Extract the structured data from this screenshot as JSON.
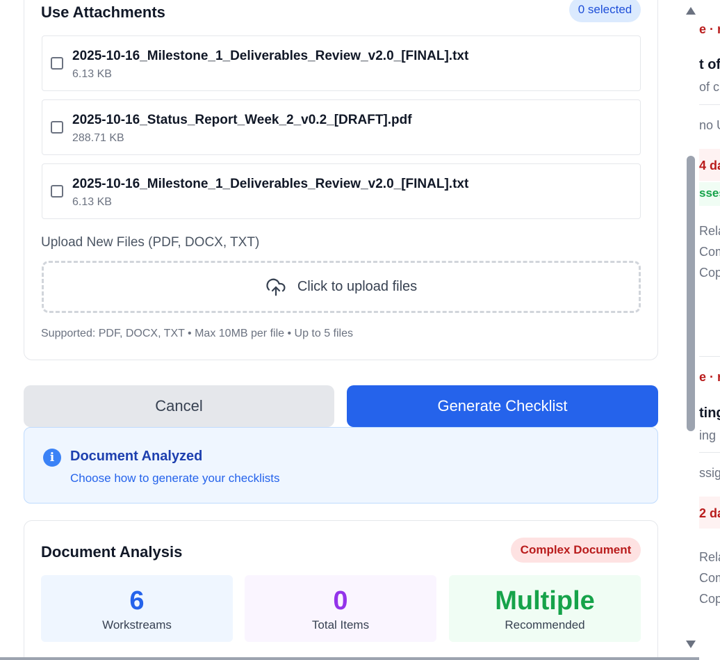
{
  "attachments": {
    "title": "Use Attachments",
    "selected_badge": "0 selected",
    "files": [
      {
        "name": "2025-10-16_Milestone_1_Deliverables_Review_v2.0_[FINAL].txt",
        "size": "6.13 KB",
        "checked": false
      },
      {
        "name": "2025-10-16_Status_Report_Week_2_v0.2_[DRAFT].pdf",
        "size": "288.71 KB",
        "checked": false
      },
      {
        "name": "2025-10-16_Milestone_1_Deliverables_Review_v2.0_[FINAL].txt",
        "size": "6.13 KB",
        "checked": false
      }
    ],
    "upload_label": "Upload New Files (PDF, DOCX, TXT)",
    "upload_prompt": "Click to upload files",
    "upload_icon": "cloud-upload-icon",
    "hint": "Supported: PDF, DOCX, TXT • Max 10MB per file • Up to 5 files"
  },
  "actions": {
    "cancel_label": "Cancel",
    "generate_label": "Generate Checklist"
  },
  "info": {
    "icon": "info-icon",
    "title": "Document Analyzed",
    "subtitle": "Choose how to generate your checklists"
  },
  "analysis": {
    "title": "Document Analysis",
    "badge": "Complex Document",
    "stats": [
      {
        "value": "6",
        "label": "Workstreams",
        "color": "#2563eb",
        "bg": "#eff6ff"
      },
      {
        "value": "0",
        "label": "Total Items",
        "color": "#9333ea",
        "bg": "#faf5ff"
      },
      {
        "value": "Multiple",
        "label": "Recommended",
        "color": "#16a34a",
        "bg": "#f0fdf4"
      }
    ]
  },
  "background": {
    "fragments": [
      "e · r",
      "t of",
      "of c",
      "no U",
      "4 da",
      "sses",
      "Rela",
      "Com",
      "Cop",
      "e · r",
      "ting",
      "ing",
      "ssig",
      "2 da",
      "Rela",
      "Com",
      "Cop"
    ]
  },
  "colors": {
    "primary": "#2563eb",
    "info_bg": "#eff6ff",
    "danger": "#b91c1c"
  }
}
